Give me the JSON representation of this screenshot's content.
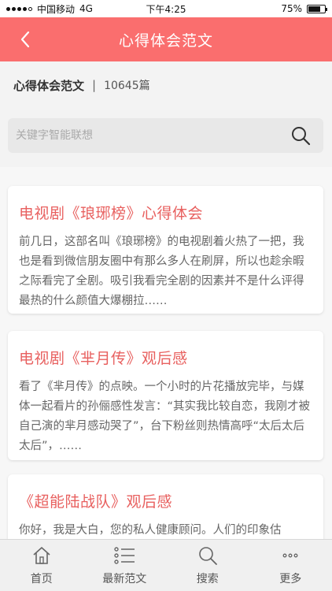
{
  "status_bar": {
    "carrier": "中国移动",
    "network": "4G",
    "time": "下午4:25",
    "battery": "75%",
    "battery_level": 0.75
  },
  "nav": {
    "title": "心得体会范文"
  },
  "subheader": {
    "title": "心得体会范文",
    "separator": "|",
    "count": "10645篇"
  },
  "search": {
    "placeholder": "关键字智能联想"
  },
  "articles": [
    {
      "title": "电视剧《琅琊榜》心得体会",
      "excerpt": "前几日，这部名叫《琅琊榜》的电视剧着火热了一把，我也是看到微信朋友圈中有那么多人在刷屏，所以也趁余暇之际看完了全剧。吸引我看完全剧的因素并不是什么评得最热的什么颜值大爆棚拉……"
    },
    {
      "title": "电视剧《芈月传》观后感",
      "excerpt": "看了《芈月传》的点映。一个小时的片花播放完毕，与媒体一起看片的孙俪感性发言：“其实我比较自恋，我刚才被自己演的芈月感动哭了”，台下粉丝则热情高呼“太后太后太后”，……"
    },
    {
      "title": "《超能陆战队》观后感",
      "excerpt": "你好，我是大白，您的私人健康顾问。人们的印象估"
    }
  ],
  "tabs": [
    {
      "label": "首页",
      "icon": "home-icon"
    },
    {
      "label": "最新范文",
      "icon": "list-icon"
    },
    {
      "label": "搜索",
      "icon": "search-icon"
    },
    {
      "label": "更多",
      "icon": "more-icon"
    }
  ],
  "colors": {
    "accent": "#fa6e6e",
    "title_red": "#e8605f"
  }
}
